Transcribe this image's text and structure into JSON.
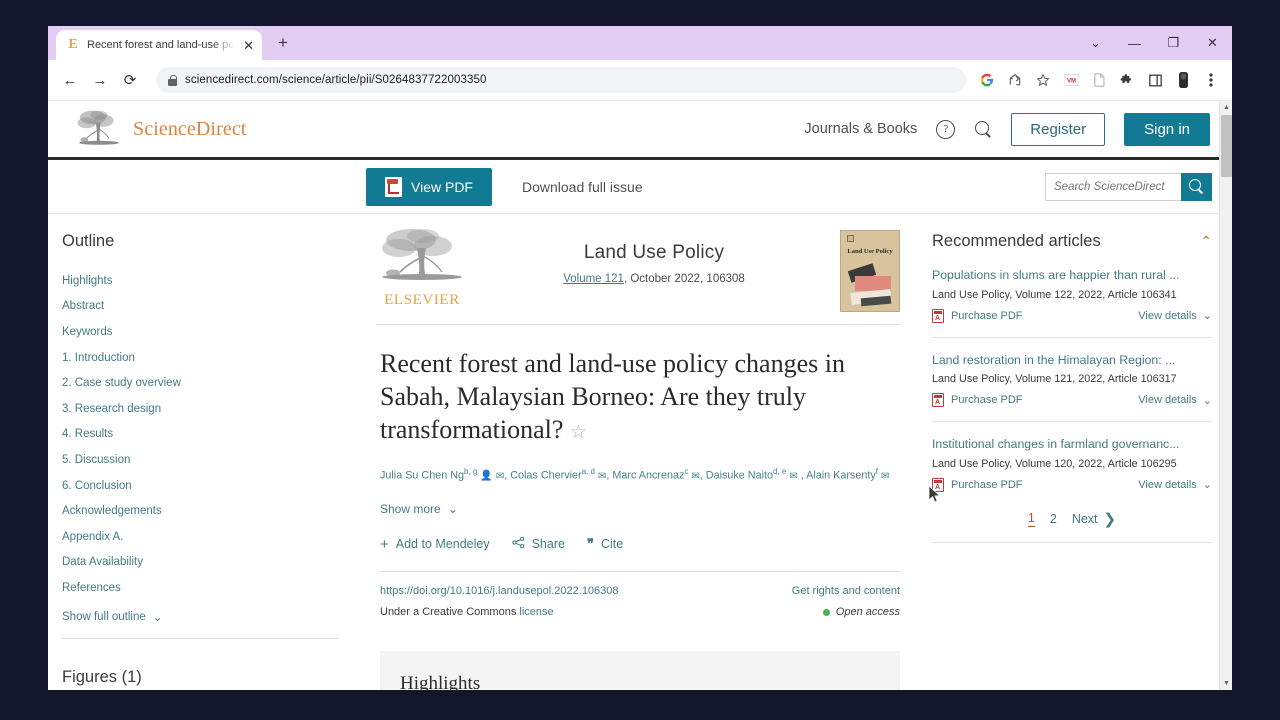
{
  "browser": {
    "tab": {
      "title": "Recent forest and land-use polic",
      "favicon": "E",
      "close": "✕"
    },
    "newtab_label": "+",
    "window_controls": {
      "dropdown": "⌄",
      "minimize": "—",
      "maximize": "❐",
      "close": "✕"
    },
    "nav": {
      "back": "←",
      "forward": "→",
      "reload": "⟳"
    },
    "url": "sciencedirect.com/science/article/pii/S0264837722003350",
    "toolbar_icons": [
      "google-icon",
      "share-icon",
      "bookmark-star-icon",
      "extension-vm-icon",
      "reader-icon",
      "puzzle-icon",
      "sidepanel-icon",
      "profile-icon",
      "menu-kebab-icon"
    ]
  },
  "site_header": {
    "brand": "ScienceDirect",
    "journals_books": "Journals & Books",
    "help": "?",
    "register": "Register",
    "signin": "Sign in"
  },
  "action_bar": {
    "view_pdf": "View PDF",
    "download_full_issue": "Download full issue",
    "search_placeholder": "Search ScienceDirect"
  },
  "outline": {
    "title": "Outline",
    "items": [
      "Highlights",
      "Abstract",
      "Keywords",
      "1. Introduction",
      "2. Case study overview",
      "3. Research design",
      "4. Results",
      "5. Discussion",
      "6. Conclusion",
      "Acknowledgements",
      "Appendix A.",
      "Data Availability",
      "References"
    ],
    "show_full": "Show full outline",
    "chevron": "⌄",
    "figures": "Figures (1)"
  },
  "article": {
    "publisher": "ELSEVIER",
    "journal": "Land Use Policy",
    "volume_link": "Volume 121",
    "volume_rest": ", October 2022, 106308",
    "cover_title": "Land Use Policy",
    "title": "Recent forest and land-use policy changes in Sabah, Malaysian Borneo: Are they truly transformational?",
    "star": "☆",
    "authors": [
      {
        "name": "Julia Su Chen Ng",
        "sup": "b, g",
        "person": true,
        "mail": true,
        "sep": ", "
      },
      {
        "name": "Colas Chervier",
        "sup": "a, d",
        "person": false,
        "mail": true,
        "sep": ", "
      },
      {
        "name": "Marc Ancrenaz",
        "sup": "c",
        "person": false,
        "mail": true,
        "sep": ", "
      },
      {
        "name": "Daisuke Naito",
        "sup": "d, e",
        "person": false,
        "mail": true,
        "sep": ""
      },
      {
        "name": ", Alain Karsenty",
        "sup": "f",
        "person": false,
        "mail": true,
        "sep": ""
      }
    ],
    "show_more": "Show more",
    "show_more_chevron": "⌄",
    "actions": [
      {
        "icon": "plus-icon",
        "glyph": "+",
        "label": "Add to Mendeley"
      },
      {
        "icon": "share-icon",
        "glyph": "⤙",
        "label": "Share"
      },
      {
        "icon": "quote-icon",
        "glyph": "❞",
        "label": "Cite"
      }
    ],
    "doi": "https://doi.org/10.1016/j.landusepol.2022.106308",
    "get_rights": "Get rights and content",
    "license_pre": "Under a Creative Commons ",
    "license_link": "license",
    "open_access": "Open access",
    "highlights_heading": "Highlights"
  },
  "recommended": {
    "title": "Recommended articles",
    "collapse_chevron": "⌃",
    "items": [
      {
        "title": "Populations in slums are happier than rural ...",
        "meta": "Land Use Policy, Volume 122, 2022, Article 106341",
        "purchase": "Purchase PDF",
        "view_details": "View details",
        "chevron": "⌄"
      },
      {
        "title": "Land restoration in the Himalayan Region: ...",
        "meta": "Land Use Policy, Volume 121, 2022, Article 106317",
        "purchase": "Purchase PDF",
        "view_details": "View details",
        "chevron": "⌄"
      },
      {
        "title": "Institutional changes in farmland governanc...",
        "meta": "Land Use Policy, Volume 120, 2022, Article 106295",
        "purchase": "Purchase PDF",
        "view_details": "View details",
        "chevron": "⌄"
      }
    ],
    "pager": {
      "page1": "1",
      "page2": "2",
      "next": "Next",
      "next_chevron": "❯"
    }
  },
  "colors": {
    "accent_teal": "#137a94",
    "link_teal": "#437b86",
    "brand_orange": "#e0843d",
    "tab_strip": "#e3cdf2",
    "open_access_green": "#4caf50"
  }
}
